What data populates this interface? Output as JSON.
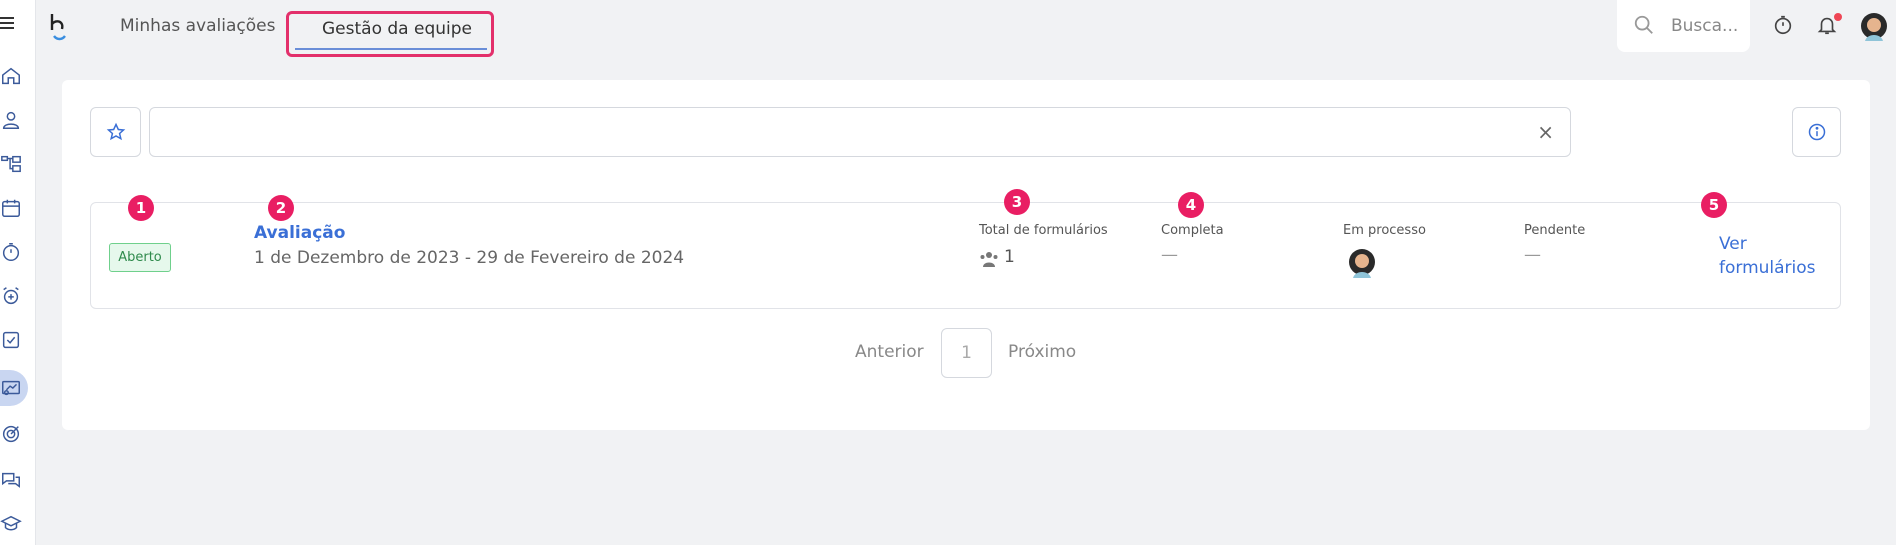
{
  "header": {
    "tabs": [
      {
        "label": "Minhas avaliações"
      },
      {
        "label": "Gestão da equipe"
      }
    ],
    "search": {
      "placeholder": "Busca..."
    }
  },
  "filter": {
    "clear_symbol": "×"
  },
  "evaluation": {
    "status": "Aberto",
    "title": "Avaliação",
    "period": "1 de Dezembro de 2023 - 29 de Fevereiro de 2024",
    "columns": {
      "total_label": "Total de formulários",
      "total_value": "1",
      "complete_label": "Completa",
      "complete_value": "—",
      "in_process_label": "Em processo",
      "pending_label": "Pendente",
      "pending_value": "—"
    },
    "action_label": "Ver formulários"
  },
  "pagination": {
    "prev_label": "Anterior",
    "current_page": "1",
    "next_label": "Próximo"
  },
  "markers": [
    "1",
    "2",
    "3",
    "4",
    "5"
  ],
  "colors": {
    "accent": "#3a6fd6",
    "highlight": "#e3306b",
    "marker": "#e91e63",
    "badge_green": "#6fd08c",
    "notification_dot": "#ef4655"
  }
}
